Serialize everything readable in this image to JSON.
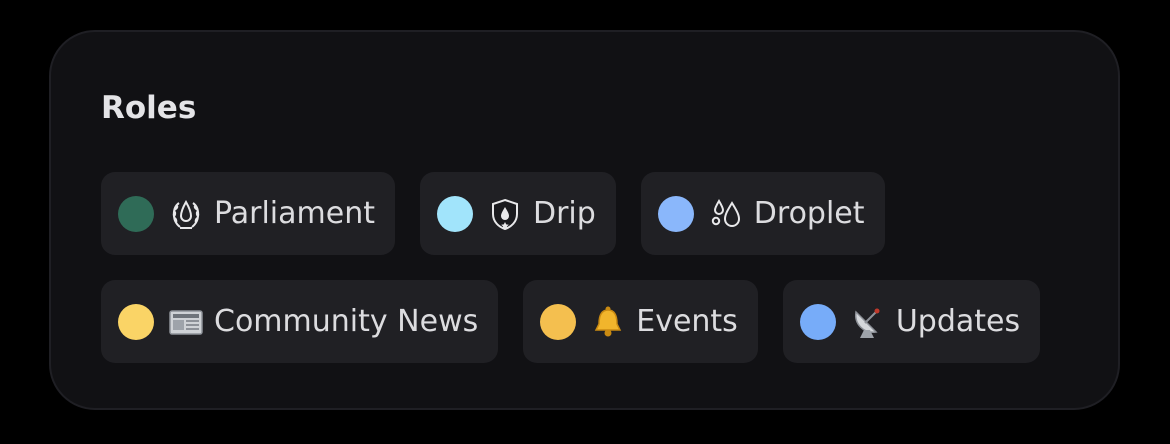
{
  "title": "Roles",
  "roles": [
    {
      "label": "Parliament",
      "color": "#2f6b57",
      "icon": "laurel-droplet-icon"
    },
    {
      "label": "Drip",
      "color": "#a1e4fb",
      "icon": "shield-droplet-icon"
    },
    {
      "label": "Droplet",
      "color": "#8ab7fb",
      "icon": "droplets-icon"
    },
    {
      "label": "Community News",
      "color": "#fad466",
      "icon": "newspaper-icon"
    },
    {
      "label": "Events",
      "color": "#f4bf4f",
      "icon": "bell-icon"
    },
    {
      "label": "Updates",
      "color": "#77acf9",
      "icon": "satellite-antenna-icon"
    }
  ]
}
